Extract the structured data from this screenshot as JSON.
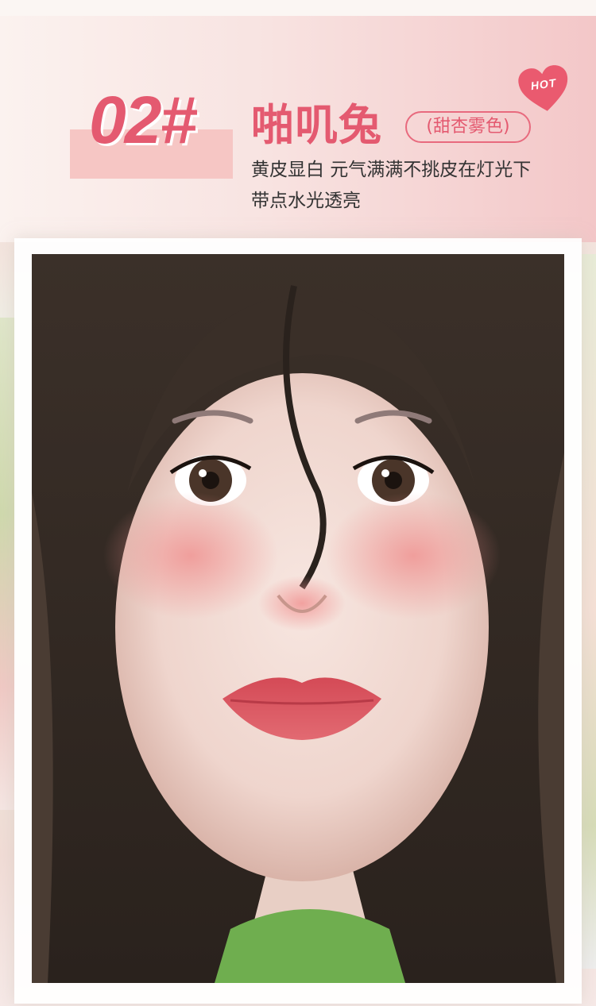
{
  "product": {
    "number": "02#",
    "name": "啪叽兔",
    "shade_tag": "(甜杏雾色)",
    "description_lines": [
      "黄皮显白 元气满满不挑皮在灯光下",
      "带点水光透亮"
    ],
    "badge": "HOT"
  },
  "photo": {
    "subject": "model-face-with-blush"
  },
  "colors": {
    "accent": "#e45a70",
    "number_highlight": "#f6c6c4",
    "badge": "#ea5a6f"
  }
}
